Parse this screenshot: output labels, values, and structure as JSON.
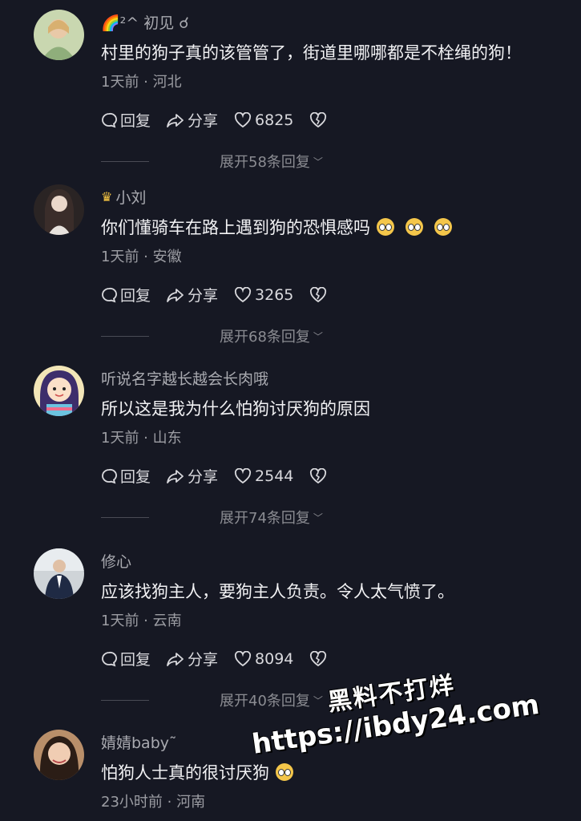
{
  "comments": [
    {
      "username": "🌈²^ 初见 ☌",
      "text": "村里的狗子真的该管管了，街道里哪哪都是不栓绳的狗！",
      "meta": "1天前 · 河北",
      "reply_label": "回复",
      "share_label": "分享",
      "likes": "6825",
      "expand": "展开58条回复"
    },
    {
      "username": "小刘",
      "text": "你们懂骑车在路上遇到狗的恐惧感吗",
      "meta": "1天前 · 安徽",
      "reply_label": "回复",
      "share_label": "分享",
      "likes": "3265",
      "expand": "展开68条回复"
    },
    {
      "username": "听说名字越长越会长肉哦",
      "text": "所以这是我为什么怕狗讨厌狗的原因",
      "meta": "1天前 · 山东",
      "reply_label": "回复",
      "share_label": "分享",
      "likes": "2544",
      "expand": "展开74条回复"
    },
    {
      "username": "修心",
      "text": "应该找狗主人，要狗主人负责。令人太气愤了。",
      "meta": "1天前 · 云南",
      "reply_label": "回复",
      "share_label": "分享",
      "likes": "8094",
      "expand": "展开40条回复"
    },
    {
      "username": "婧婧baby˜",
      "text": "怕狗人士真的很讨厌狗",
      "meta": "23小时前 · 河南"
    }
  ],
  "watermark": {
    "line1": "黑料不打烊",
    "line2": "https://ibdy24.com"
  },
  "colors": {
    "background": "#161823",
    "text": "#f2f2f4",
    "secondary": "#9c9da3"
  },
  "icons": [
    "comment-icon",
    "share-icon",
    "heart-icon",
    "dislike-heart-icon",
    "chevron-down-icon",
    "crown-icon"
  ]
}
